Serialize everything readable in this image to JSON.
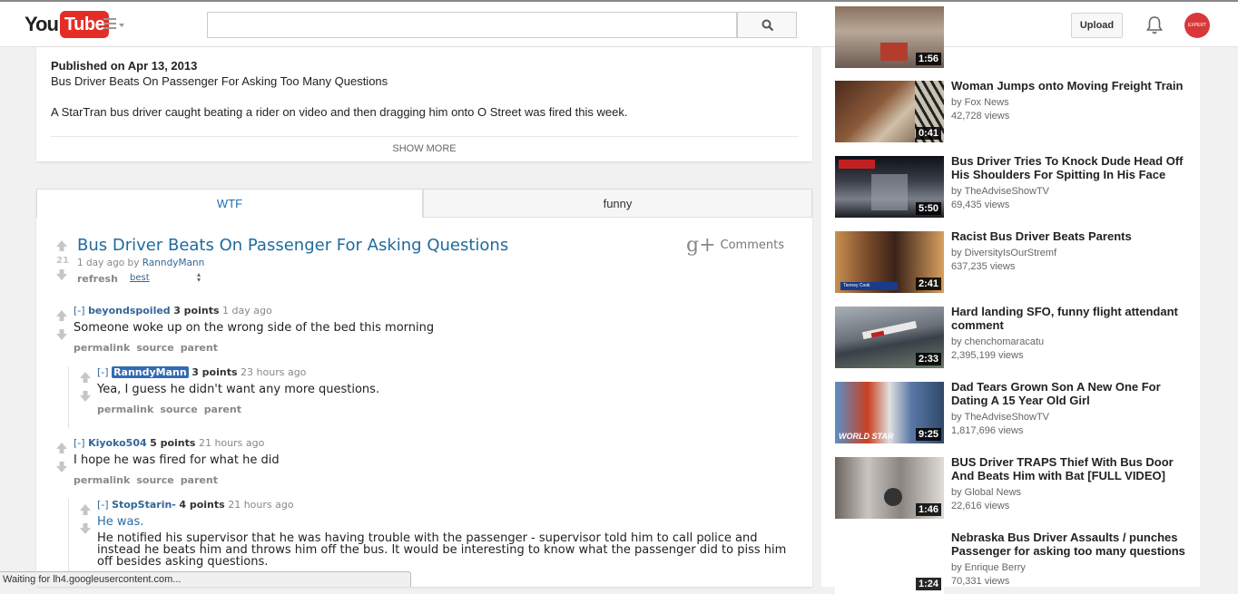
{
  "header": {
    "logo_you": "You",
    "logo_tube": "Tube",
    "search_placeholder": "",
    "upload_label": "Upload",
    "avatar_text": "EXPERT VILLAGE"
  },
  "description": {
    "published": "Published on Apr 13, 2013",
    "title": "Bus Driver Beats On Passenger For Asking Too Many Questions",
    "text": "A StarTran bus driver caught beating a rider on video and then dragging him onto O Street was fired this week.",
    "show_more": "SHOW MORE"
  },
  "comments": {
    "tabs": [
      {
        "label": "WTF"
      },
      {
        "label": "funny"
      }
    ],
    "post": {
      "score": "21",
      "title": "Bus Driver Beats On Passenger For Asking Questions",
      "age": "1 day ago by",
      "author": "RanndyMann",
      "refresh": "refresh",
      "sort": "best"
    },
    "gplus_label": "Comments",
    "list": [
      {
        "toggle": "[-]",
        "user": "beyondspoiled",
        "points": "3 points",
        "age": "1 day ago",
        "body": "Someone woke up on the wrong side of the bed this morning"
      },
      {
        "toggle": "[-]",
        "user": "RanndyMann",
        "points": "3 points",
        "age": "23 hours ago",
        "body": "Yea, I guess he didn't want any more questions."
      },
      {
        "toggle": "[-]",
        "user": "Kiyoko504",
        "points": "5 points",
        "age": "21 hours ago",
        "body": "I hope he was fired for what he did"
      },
      {
        "toggle": "[-]",
        "user": "StopStarin-",
        "points": "4 points",
        "age": "21 hours ago",
        "body_lead": "He was.",
        "body_l1": "He notified his supervisor that he was having trouble with the passenger - supervisor told him to call police and",
        "body_l2": "instead he beats him and throws him off the bus. It would be interesting to know what the passenger did to piss him",
        "body_l3": "off besides asking questions."
      }
    ],
    "links": {
      "permalink": "permalink",
      "source": "source",
      "parent": "parent"
    }
  },
  "related": [
    {
      "duration": "1:56"
    },
    {
      "title": "Woman Jumps onto Moving Freight Train",
      "by": "by Fox News",
      "views": "42,728 views",
      "duration": "0:41"
    },
    {
      "title": "Bus Driver Tries To Knock Dude Head Off His Shoulders For Spitting In His Face",
      "by": "by TheAdviseShowTV",
      "views": "69,435 views",
      "duration": "5:50"
    },
    {
      "title": "Racist Bus Driver Beats Parents",
      "by": "by DiversityIsOurStremf",
      "views": "637,235 views",
      "duration": "2:41",
      "thumb_caption": "Tierney Cook"
    },
    {
      "title": "Hard landing SFO, funny flight attendant comment",
      "by": "by chenchomaracatu",
      "views": "2,395,199 views",
      "duration": "2:33"
    },
    {
      "title": "Dad Tears Grown Son A New One For Dating A 15 Year Old Girl",
      "by": "by TheAdviseShowTV",
      "views": "1,817,696 views",
      "duration": "9:25",
      "thumb_caption": "WORLD STAR"
    },
    {
      "title": "BUS Driver TRAPS Thief With Bus Door And Beats Him with Bat [FULL VIDEO]",
      "by": "by Global News",
      "views": "22,616 views",
      "duration": "1:46"
    },
    {
      "title": "Nebraska Bus Driver Assaults / punches Passenger for asking too many questions",
      "by": "by Enrique Berry",
      "views": "70,331 views",
      "duration": "1:24"
    }
  ],
  "status_bar": "Waiting for lh4.googleusercontent.com...",
  "colors": {
    "brand_red": "#e52d27",
    "link_blue": "#1e6cb7",
    "reddit_blue": "#336699"
  }
}
